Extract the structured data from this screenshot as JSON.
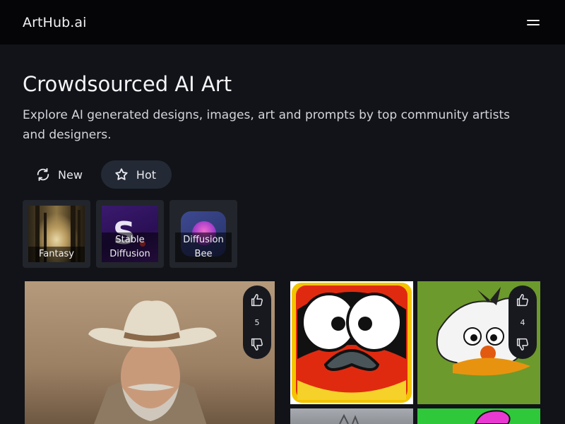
{
  "header": {
    "logo": "ArtHub.ai",
    "menu_icon": "hamburger-menu-icon"
  },
  "hero": {
    "title": "Crowdsourced AI Art",
    "subtitle": "Explore AI generated designs, images, art and prompts by top community artists and designers."
  },
  "sort_tabs": [
    {
      "label": "New",
      "icon": "refresh-icon",
      "active": false
    },
    {
      "label": "Hot",
      "icon": "star-icon",
      "active": true
    }
  ],
  "categories": [
    {
      "label": "Fantasy"
    },
    {
      "label": "Stable\nDiffusion"
    },
    {
      "label": "Diffusion\nBee"
    }
  ],
  "gallery": [
    {
      "subject": "cowboy portrait",
      "votes": "5"
    },
    {
      "subject": "cartoon penguin",
      "votes": null
    },
    {
      "subject": "cartoon bird",
      "votes": "4"
    },
    {
      "subject": "grey sky image",
      "votes": null
    },
    {
      "subject": "pink figure on green",
      "votes": null
    }
  ],
  "colors": {
    "background": "#111318",
    "topbar": "#050507",
    "active_tab": "#232a35",
    "category_card": "#22252b",
    "vote_pill": "#17191f"
  }
}
